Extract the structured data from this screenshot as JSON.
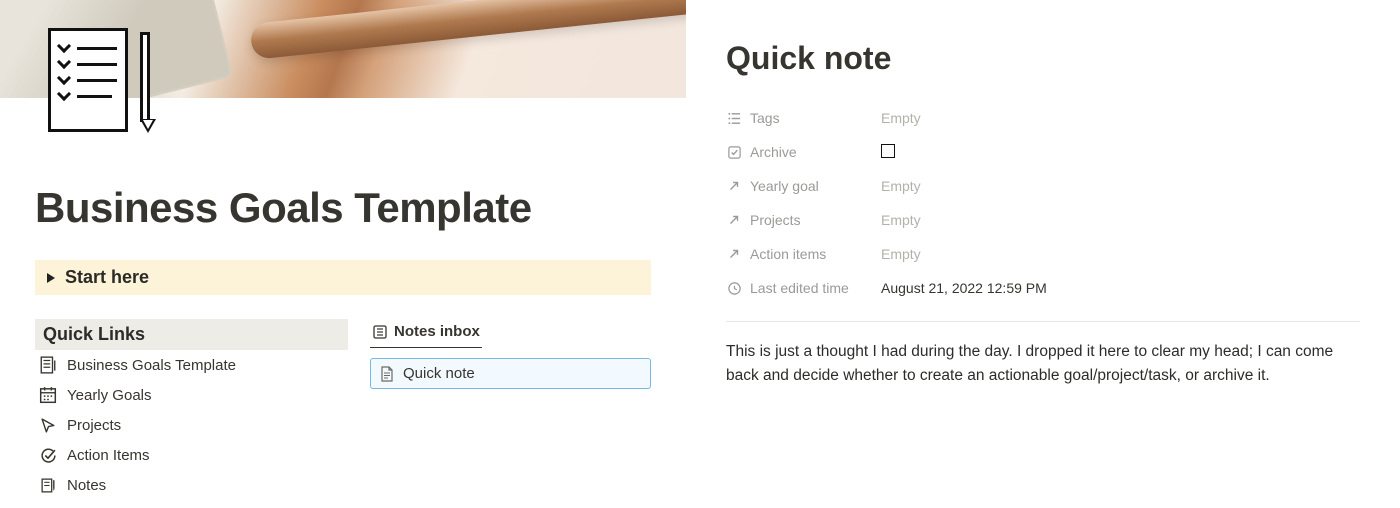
{
  "leftPane": {
    "pageTitle": "Business Goals Template",
    "startHere": "Start here",
    "quickLinksHeading": "Quick Links",
    "quickLinks": [
      {
        "label": "Business Goals Template"
      },
      {
        "label": "Yearly Goals"
      },
      {
        "label": "Projects"
      },
      {
        "label": "Action Items"
      },
      {
        "label": "Notes"
      }
    ],
    "inboxHeading": "Notes inbox",
    "inboxItem": "Quick note"
  },
  "rightPane": {
    "title": "Quick note",
    "properties": {
      "tags": {
        "label": "Tags",
        "value": "Empty",
        "isEmpty": true
      },
      "archive": {
        "label": "Archive"
      },
      "yearlyGoal": {
        "label": "Yearly goal",
        "value": "Empty",
        "isEmpty": true
      },
      "projects": {
        "label": "Projects",
        "value": "Empty",
        "isEmpty": true
      },
      "actionItems": {
        "label": "Action items",
        "value": "Empty",
        "isEmpty": true
      },
      "lastEdited": {
        "label": "Last edited time",
        "value": "August 21, 2022 12:59 PM",
        "isEmpty": false
      }
    },
    "body": "This is just a thought I had during the day. I dropped it here to clear my head; I can come back and decide whether to create an actionable goal/project/task, or archive it."
  }
}
